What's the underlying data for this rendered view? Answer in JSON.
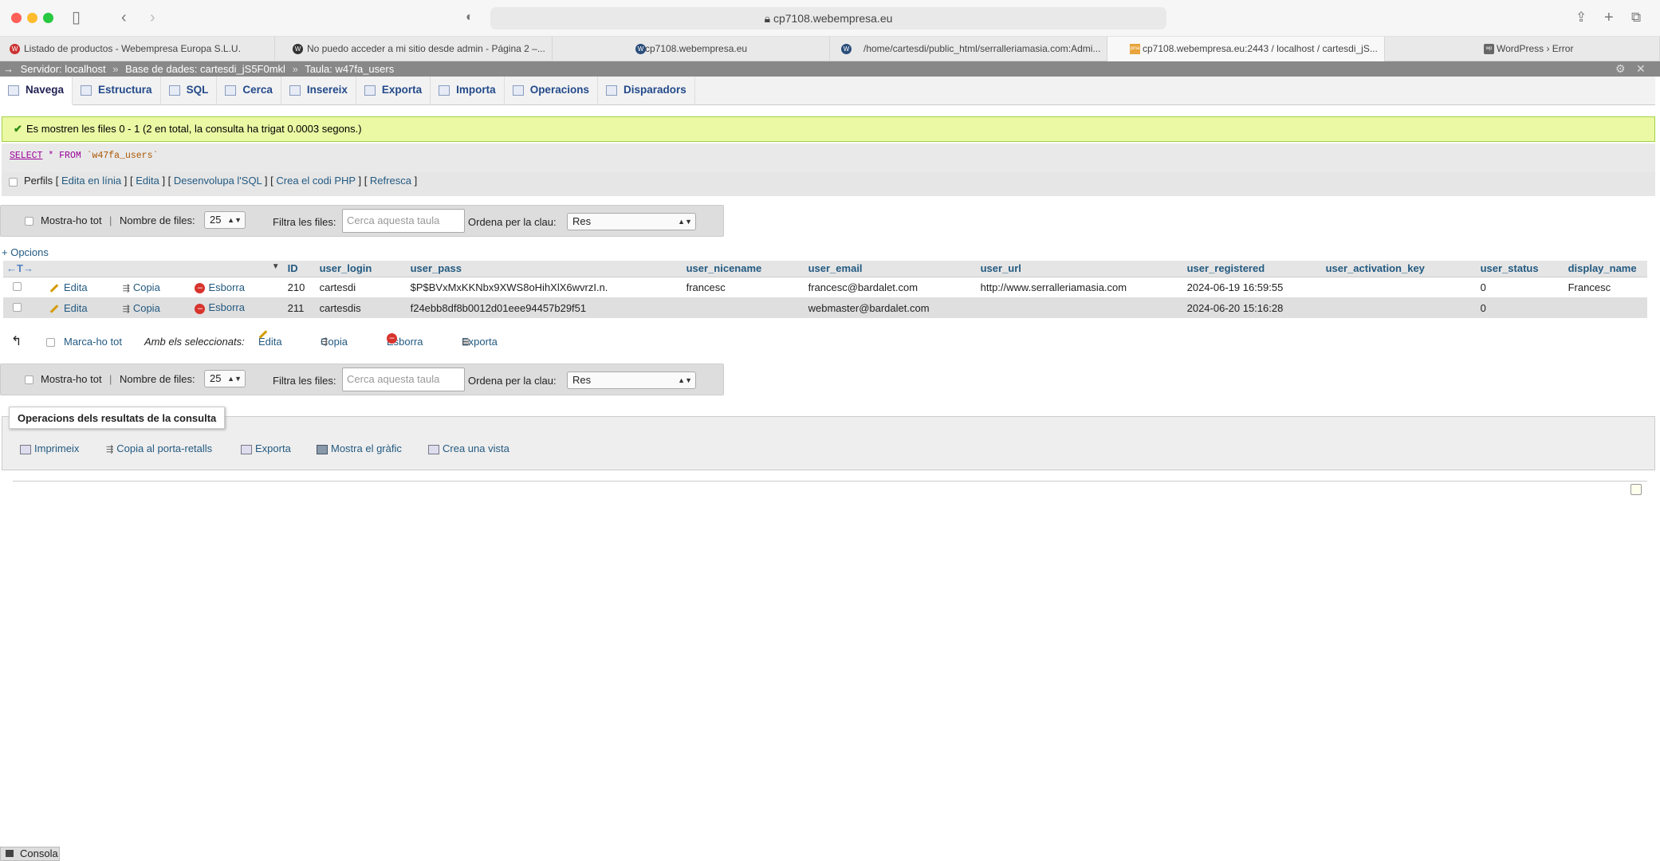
{
  "browser": {
    "url": "cp7108.webempresa.eu",
    "tabs": [
      {
        "label": "Listado de productos - Webempresa Europa S.L.U.",
        "favicon": "W"
      },
      {
        "label": "No puedo acceder a mi sitio desde admin - Página 2 –...",
        "favicon": "W"
      },
      {
        "label": "cp7108.webempresa.eu",
        "favicon": "W"
      },
      {
        "label": "/home/cartesdi/public_html/serralleriamasia.com:Admi...",
        "favicon": "W"
      },
      {
        "label": "cp7108.webempresa.eu:2443 / localhost / cartesdi_jS...",
        "favicon": "pma"
      },
      {
        "label": "WordPress › Error",
        "favicon": "wp"
      }
    ]
  },
  "breadcrumb": {
    "server": "Servidor: localhost",
    "database": "Base de dades: cartesdi_jS5F0mkl",
    "table": "Taula: w47fa_users",
    "separator": "»"
  },
  "menu": [
    {
      "label": "Navega",
      "active": true,
      "icon": "browse-icon"
    },
    {
      "label": "Estructura",
      "icon": "structure-icon"
    },
    {
      "label": "SQL",
      "icon": "sql-icon"
    },
    {
      "label": "Cerca",
      "icon": "search-icon"
    },
    {
      "label": "Insereix",
      "icon": "insert-icon"
    },
    {
      "label": "Exporta",
      "icon": "export-icon"
    },
    {
      "label": "Importa",
      "icon": "import-icon"
    },
    {
      "label": "Operacions",
      "icon": "operations-icon"
    },
    {
      "label": "Disparadors",
      "icon": "triggers-icon"
    }
  ],
  "success": "Es mostren les files 0 - 1 (2 en total, la consulta ha trigat 0.0003 segons.)",
  "sql": {
    "select": "SELECT",
    "star": "*",
    "from": "FROM",
    "table": "`w47fa_users`"
  },
  "profiling": {
    "label": "Perfils",
    "links": [
      "Edita en línia",
      "Edita",
      "Desenvolupa l'SQL",
      "Crea el codi PHP",
      "Refresca"
    ]
  },
  "nav": {
    "show_all": "Mostra-ho tot",
    "rows_label": "Nombre de files:",
    "rows_value": "25",
    "filter_label": "Filtra les files:",
    "filter_placeholder": "Cerca aquesta taula",
    "sort_label": "Ordena per la clau:",
    "sort_value": "Res"
  },
  "options_link": "+ Opcions",
  "table": {
    "columns": [
      "ID",
      "user_login",
      "user_pass",
      "user_nicename",
      "user_email",
      "user_url",
      "user_registered",
      "user_activation_key",
      "user_status",
      "display_name"
    ],
    "actions": {
      "edit": "Edita",
      "copy": "Copia",
      "delete": "Esborra"
    },
    "rows": [
      [
        "210",
        "cartesdi",
        "$P$BVxMxKKNbx9XWS8oHihXlX6wvrzI.n.",
        "francesc",
        "francesc@bardalet.com",
        "http://www.serralleriamasia.com",
        "2024-06-19 16:59:55",
        "",
        "0",
        "Francesc"
      ],
      [
        "211",
        "cartesdis",
        "f24ebb8df8b0012d01eee94457b29f51",
        "",
        "webmaster@bardalet.com",
        "",
        "2024-06-20 15:16:28",
        "",
        "0",
        ""
      ]
    ]
  },
  "bulk": {
    "check_all": "Marca-ho tot",
    "with_selected": "Amb els seleccionats:",
    "edit": "Edita",
    "copy": "Copia",
    "delete": "Esborra",
    "export": "Exporta"
  },
  "query_ops": {
    "title": "Operacions dels resultats de la consulta",
    "links": [
      "Imprimeix",
      "Copia al porta-retalls",
      "Exporta",
      "Mostra el gràfic",
      "Crea una vista"
    ]
  },
  "console": "Consola"
}
